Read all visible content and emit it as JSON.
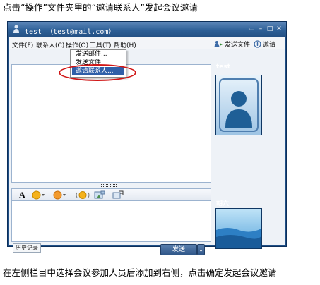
{
  "captions": {
    "top": "点击“操作”文件夹里的“邀请联系人”发起会议邀请",
    "bottom": "在左侧栏目中选择会议参加人员后添加到右侧，点击确定发起会议邀请"
  },
  "window": {
    "title": "test （test@mail.com）",
    "buttons": [
      "▭",
      "–",
      "□",
      "✕"
    ]
  },
  "menubar": {
    "items": [
      "文件(F)",
      "联系人(C)",
      "操作(O)",
      "工具(T)",
      "帮助(H)"
    ],
    "send_file": "发送文件",
    "invite": "邀请"
  },
  "dropdown": {
    "items": [
      "发送邮件...",
      "发送文件",
      "邀请联系人..."
    ],
    "selected_index": 2
  },
  "format_toolbar": {
    "font_label": "A"
  },
  "bottom_bar": {
    "history": "历史记录",
    "send": "发送"
  },
  "contacts": {
    "self_name": "test",
    "peer_name": "胡六"
  },
  "colors": {
    "window_frame": "#1f4f86",
    "selection": "#2f5fa8",
    "highlight_ellipse": "#d01616"
  }
}
